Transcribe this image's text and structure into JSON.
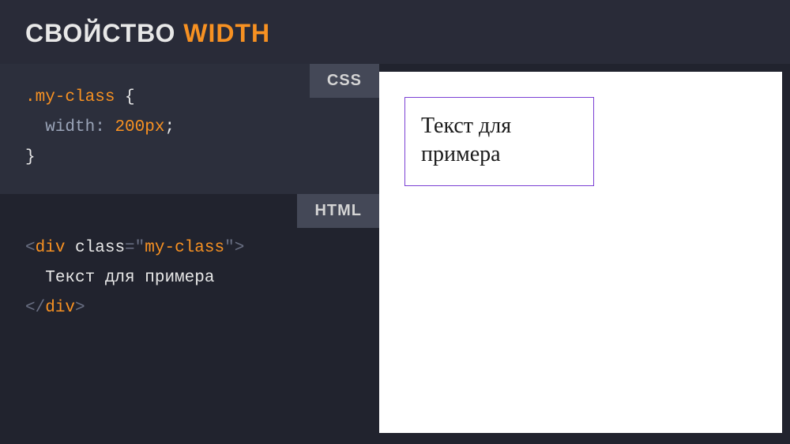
{
  "header": {
    "title_prefix": "СВОЙСТВО ",
    "title_accent": "WIDTH"
  },
  "tabs": {
    "css": "CSS",
    "html": "HTML"
  },
  "css_code": {
    "selector": ".my-class",
    "brace_open": " {",
    "indent": "  ",
    "property": "width",
    "colon": ": ",
    "value": "200px",
    "semicolon": ";",
    "brace_close": "}"
  },
  "html_code": {
    "angle_open": "<",
    "tag": "div",
    "space": " ",
    "attr": "class",
    "eq": "=",
    "quote": "\"",
    "attr_val": "my-class",
    "angle_close": ">",
    "indent": "  ",
    "text": "Текст для примера",
    "slash": "/",
    "close_angle_open": "</",
    "close_angle_close": ">"
  },
  "preview": {
    "text": "Текст для примера"
  }
}
